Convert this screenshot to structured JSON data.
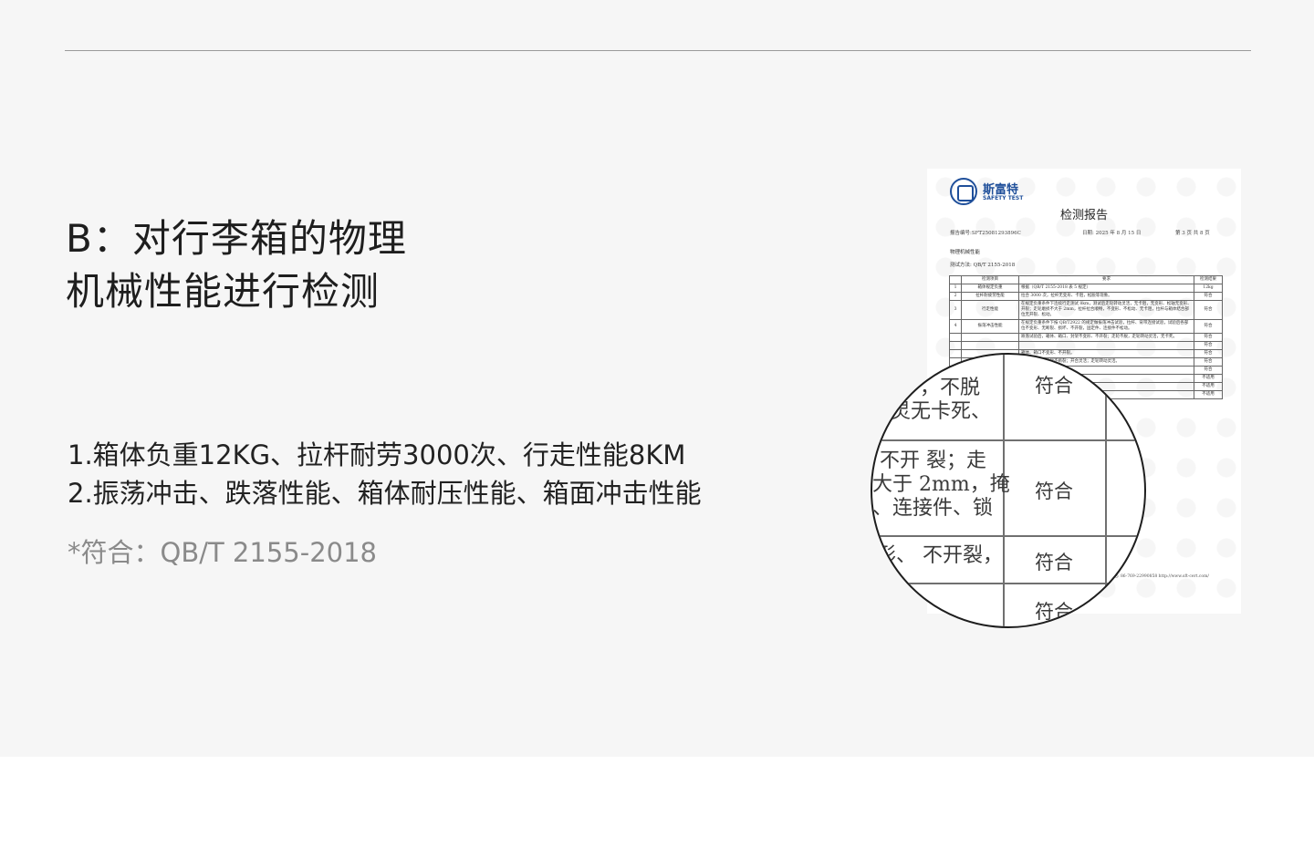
{
  "heading": {
    "line1": "B：对行李箱的物理",
    "line2": "机械性能进行检测"
  },
  "features": {
    "line1": "1.箱体负重12KG、拉杆耐劳3000次、行走性能8KM",
    "line2": "2.振荡冲击、跌落性能、箱体耐压性能、箱面冲击性能"
  },
  "standard": "*符合：QB/T 2155-2018",
  "report": {
    "brand_cn": "斯富特",
    "brand_en": "SAFETY TEST",
    "title": "检测报告",
    "report_no": "报告编号:SFT25081293896C",
    "date": "日期: 2025 年 8 月 15 日",
    "page": "第 3 页 共 8 页",
    "section": "物理机械性能",
    "method": "测试方法:    QB/T 2155-2018",
    "headers": [
      "检测项目",
      "要求",
      "检测结果"
    ],
    "rows": [
      {
        "no": "1",
        "item": "箱体规定负重",
        "req": "根据（QB/T 2155-2018 表 5 规定）",
        "result": "12kg"
      },
      {
        "no": "2",
        "item": "拉杆耐疲劳性能",
        "req": "拉合 3000 次，拉杆无变形、卡阻，松脱等现象。",
        "result": "符合"
      },
      {
        "no": "3",
        "item": "行走性能",
        "req": "在规定负重条件下连续行走测试 8km，测试后走轮转动灵活，无卡阻，无变形、松轴无变形、开裂；走轮磨损不大于 2mm，拉杆拉合顺畅，不变形、不松动、无卡阻，拉杆与箱体结合部位无开裂、松动。",
        "result": "符合"
      },
      {
        "no": "4",
        "item": "振荡冲击性能",
        "req": "在规定负重条件下按 QB/T2922 的规定做振荡冲击试验，拉杆、背带连接试验，试验后各部位不变形、无断裂、损坏、不开裂，固定件、连接件不松动。",
        "result": "符合"
      },
      {
        "no": "",
        "item": "",
        "req": "跌落试验后，箱体、箱口、封架不变形、不开裂；走轮不脱，走轮转动灵活，无卡死。",
        "result": "符合"
      },
      {
        "no": "",
        "item": "",
        "req": "",
        "result": "符合"
      },
      {
        "no": "",
        "item": "",
        "req": "箱体、箱口不变形、不开裂。",
        "result": "符合"
      },
      {
        "no": "",
        "item": "",
        "req": "拉杆、轮轴、支架不断裂；开合灵活；走轮转动灵活。",
        "result": "符合"
      },
      {
        "no": "",
        "item": "",
        "req": "",
        "result": "符合"
      },
      {
        "no": "",
        "item": "",
        "req": "有效面积上不小于",
        "result": "不适用"
      },
      {
        "no": "",
        "item": "",
        "req": "不大于 1mm²",
        "result": "不适用"
      },
      {
        "no": "",
        "item": "",
        "req": "1/4，湿擦≥3",
        "result": "不适用"
      }
    ],
    "footer": "电话: 86-769-22990858    http://www.sft-cert.com/"
  },
  "magnifier": {
    "t1": "，不脱",
    "t2": "灵无卡死、",
    "t3": "不开 裂；走",
    "t4": "大于 2mm，掩",
    "t5": "、连接件、锁",
    "t6": "形、 不开裂，",
    "pass": "符合"
  }
}
